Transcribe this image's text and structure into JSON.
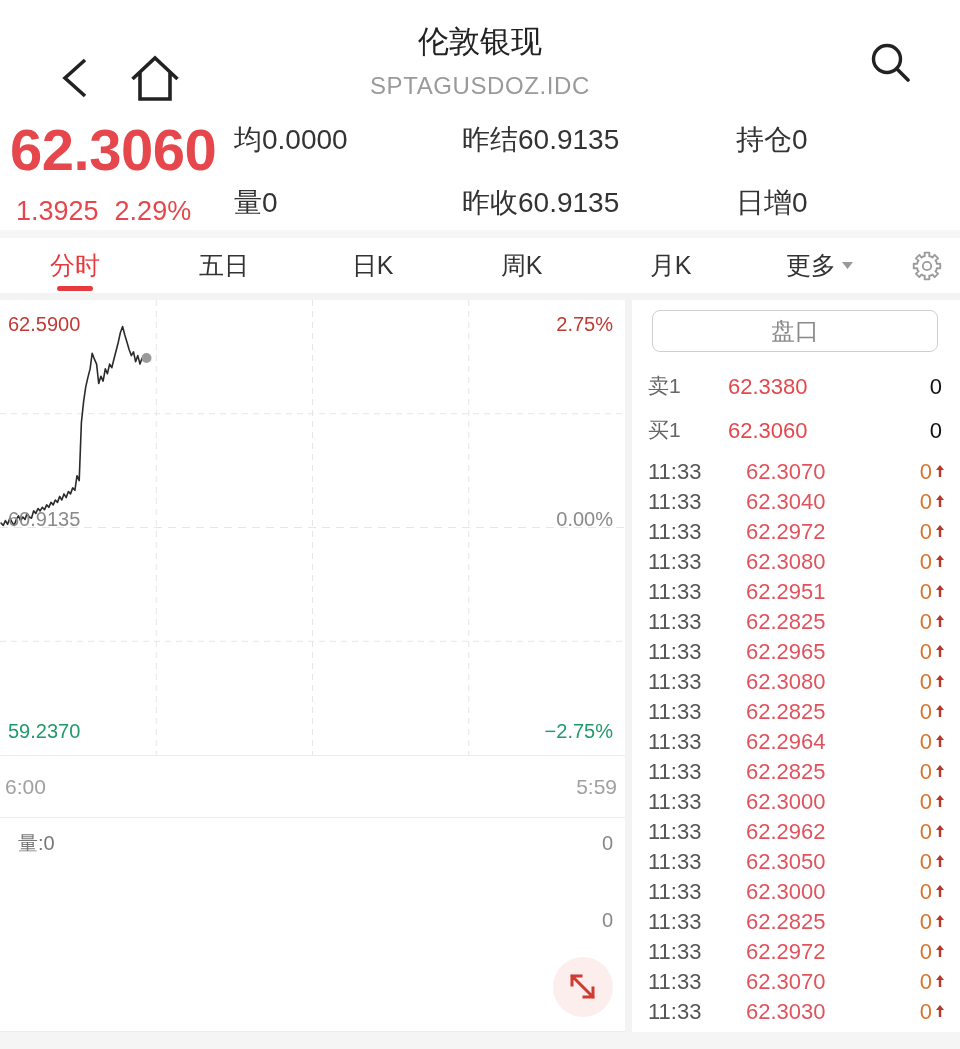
{
  "header": {
    "title": "伦敦银现",
    "code": "SPTAGUSDOZ.IDC"
  },
  "quote": {
    "price": "62.3060",
    "change": "1.3925",
    "change_pct": "2.29%",
    "rising": true,
    "stats": [
      "均0.0000",
      "昨结60.9135",
      "持仓0",
      "量0",
      "昨收60.9135",
      "日增0"
    ]
  },
  "tabs": [
    {
      "label": "分时",
      "selected": true,
      "kind": "tab"
    },
    {
      "label": "五日",
      "selected": false,
      "kind": "tab"
    },
    {
      "label": "日K",
      "selected": false,
      "kind": "tab"
    },
    {
      "label": "周K",
      "selected": false,
      "kind": "tab"
    },
    {
      "label": "月K",
      "selected": false,
      "kind": "tab"
    },
    {
      "label": "更多",
      "selected": false,
      "kind": "dropdown"
    }
  ],
  "chart": {
    "chart_data": {
      "type": "line",
      "categories": [
        null,
        null,
        null,
        null,
        null,
        null,
        null,
        null,
        null,
        null,
        null,
        null,
        null,
        null,
        null,
        null,
        null,
        null,
        null,
        null,
        null,
        null,
        null,
        null,
        null,
        null,
        null,
        null,
        null,
        null,
        null,
        null,
        null,
        null,
        null,
        null,
        null,
        null,
        null,
        null,
        null,
        null,
        null,
        null,
        null,
        null,
        null,
        null,
        null,
        null,
        null,
        null,
        null,
        null,
        null,
        null,
        null,
        null,
        null,
        null,
        null,
        null,
        null,
        null,
        null,
        null,
        null,
        null,
        null,
        null,
        null,
        null,
        null,
        null,
        null,
        null,
        null,
        null,
        null,
        null,
        null,
        null,
        null,
        null,
        null,
        null,
        null,
        null,
        null,
        null,
        null,
        null,
        null,
        null,
        null,
        null,
        null,
        null,
        null,
        null,
        null,
        null,
        null,
        null,
        null,
        null,
        null,
        null,
        null,
        null,
        null,
        null,
        null,
        null,
        null,
        null,
        null,
        null,
        null,
        null,
        null,
        null,
        null,
        null,
        null,
        null,
        null,
        null,
        null,
        null,
        null,
        null,
        null,
        null,
        null,
        null,
        null,
        null,
        null,
        null,
        null,
        null,
        null,
        null,
        null,
        null,
        null,
        null,
        null,
        null,
        null,
        null,
        null,
        null,
        null,
        null,
        null,
        null,
        null,
        null,
        null,
        null,
        null,
        null,
        null,
        null,
        null,
        null,
        null,
        null,
        null,
        null,
        null,
        null,
        null,
        null,
        null,
        null,
        null,
        null,
        null,
        null,
        null,
        null,
        null,
        null,
        null,
        null,
        null,
        null,
        null,
        null,
        null,
        null,
        null,
        null,
        null,
        null,
        null,
        null,
        null,
        null,
        null,
        null,
        null,
        null,
        null,
        null,
        null,
        null,
        null,
        null,
        null,
        null,
        null,
        null,
        null,
        null,
        null,
        null,
        null,
        null,
        null,
        null,
        null,
        null,
        null,
        null,
        null,
        null,
        null,
        null,
        null,
        null,
        null,
        null,
        null,
        null,
        null,
        null,
        null,
        null,
        null,
        null,
        null,
        null,
        null,
        null,
        null,
        null,
        null,
        null,
        null,
        null,
        null,
        null,
        null,
        null,
        null,
        null,
        null,
        null,
        null,
        null,
        null,
        null,
        null,
        null,
        null,
        null,
        null,
        null,
        null,
        null,
        null,
        null,
        null,
        null,
        null,
        null,
        null,
        null,
        null,
        null,
        null,
        null,
        null,
        null
      ],
      "series": [
        {
          "color": "#2b2b2b",
          "values": [
            60.95,
            60.93,
            60.97,
            60.94,
            60.99,
            60.96,
            60.93,
            60.98,
            61.01,
            60.97,
            61.0,
            60.98,
            61.03,
            61.0,
            60.99,
            61.05,
            61.03,
            61.07,
            61.05,
            61.08,
            61.06,
            61.1,
            61.08,
            61.12,
            61.1,
            61.14,
            61.12,
            61.17,
            61.14,
            61.19,
            61.16,
            61.21,
            61.19,
            61.24,
            61.22,
            61.34,
            61.3,
            61.78,
            61.95,
            62.07,
            62.15,
            62.22,
            62.35,
            62.3,
            62.26,
            62.1,
            62.16,
            62.12,
            62.22,
            62.18,
            62.26,
            62.23,
            62.3,
            62.37,
            62.44,
            62.52,
            62.57,
            62.5,
            62.44,
            62.38,
            62.33,
            62.36,
            62.28,
            62.33,
            62.26,
            62.31,
            62.29,
            62.31,
            null,
            null,
            null,
            null,
            null,
            null,
            null,
            null,
            null,
            null,
            null,
            null,
            null,
            null,
            null,
            null,
            null,
            null,
            null,
            null,
            null,
            null,
            null,
            null,
            null,
            null,
            null,
            null,
            null,
            null,
            null,
            null,
            null,
            null,
            null,
            null,
            null,
            null,
            null,
            null,
            null,
            null,
            null,
            null,
            null,
            null,
            null,
            null,
            null,
            null,
            null,
            null,
            null,
            null,
            null,
            null,
            null,
            null,
            null,
            null,
            null,
            null,
            null,
            null,
            null,
            null,
            null,
            null,
            null,
            null,
            null,
            null,
            null,
            null,
            null,
            null,
            null,
            null,
            null,
            null,
            null,
            null,
            null,
            null,
            null,
            null,
            null,
            null,
            null,
            null,
            null,
            null,
            null,
            null,
            null,
            null,
            null,
            null,
            null,
            null,
            null,
            null,
            null,
            null,
            null,
            null,
            null,
            null,
            null,
            null,
            null,
            null,
            null,
            null,
            null,
            null,
            null,
            null,
            null,
            null,
            null,
            null,
            null,
            null,
            null,
            null,
            null,
            null,
            null,
            null,
            null,
            null,
            null,
            null,
            null,
            null,
            null,
            null,
            null,
            null,
            null,
            null,
            null,
            null,
            null,
            null,
            null,
            null,
            null,
            null,
            null,
            null,
            null,
            null,
            null,
            null,
            null,
            null,
            null,
            null,
            null,
            null,
            null,
            null,
            null,
            null,
            null,
            null,
            null,
            null,
            null,
            null,
            null,
            null,
            null,
            null,
            null,
            null,
            null,
            null,
            null,
            null,
            null,
            null,
            null,
            null,
            null,
            null,
            null,
            null,
            null,
            null,
            null,
            null,
            null,
            null,
            null,
            null,
            null,
            null,
            null,
            null,
            null,
            null,
            null,
            null,
            null,
            null,
            null,
            null,
            null,
            null,
            null,
            null,
            null,
            null,
            null,
            null,
            null,
            null
          ]
        }
      ],
      "ylim": [
        59.039,
        62.788
      ],
      "yticks": [
        {
          "value": 62.59,
          "label": "62.5900"
        },
        {
          "value": 60.9135,
          "label": "60.9135"
        },
        {
          "value": 59.237,
          "label": "59.2370"
        }
      ]
    },
    "right_labels": [
      "2.75%",
      "0.00%",
      "−2.75%"
    ],
    "time_labels": [
      "6:00",
      "5:59"
    ]
  },
  "volume": {
    "label": "量:0",
    "scale_labels": [
      "0",
      "0"
    ]
  },
  "order_book": {
    "title": "盘口",
    "levels": [
      {
        "label": "卖1",
        "price": "62.3380",
        "volume": "0",
        "rising": true
      },
      {
        "label": "买1",
        "price": "62.3060",
        "volume": "0",
        "rising": true
      }
    ]
  },
  "trades": [
    {
      "time": "11:33",
      "price": "62.3070",
      "volume": "0",
      "up": true
    },
    {
      "time": "11:33",
      "price": "62.3040",
      "volume": "0",
      "up": true
    },
    {
      "time": "11:33",
      "price": "62.2972",
      "volume": "0",
      "up": true
    },
    {
      "time": "11:33",
      "price": "62.3080",
      "volume": "0",
      "up": true
    },
    {
      "time": "11:33",
      "price": "62.2951",
      "volume": "0",
      "up": true
    },
    {
      "time": "11:33",
      "price": "62.2825",
      "volume": "0",
      "up": true
    },
    {
      "time": "11:33",
      "price": "62.2965",
      "volume": "0",
      "up": true
    },
    {
      "time": "11:33",
      "price": "62.3080",
      "volume": "0",
      "up": true
    },
    {
      "time": "11:33",
      "price": "62.2825",
      "volume": "0",
      "up": true
    },
    {
      "time": "11:33",
      "price": "62.2964",
      "volume": "0",
      "up": true
    },
    {
      "time": "11:33",
      "price": "62.2825",
      "volume": "0",
      "up": true
    },
    {
      "time": "11:33",
      "price": "62.3000",
      "volume": "0",
      "up": true
    },
    {
      "time": "11:33",
      "price": "62.2962",
      "volume": "0",
      "up": true
    },
    {
      "time": "11:33",
      "price": "62.3050",
      "volume": "0",
      "up": true
    },
    {
      "time": "11:33",
      "price": "62.3000",
      "volume": "0",
      "up": true
    },
    {
      "time": "11:33",
      "price": "62.2825",
      "volume": "0",
      "up": true
    },
    {
      "time": "11:33",
      "price": "62.2972",
      "volume": "0",
      "up": true
    },
    {
      "time": "11:33",
      "price": "62.3070",
      "volume": "0",
      "up": true
    },
    {
      "time": "11:33",
      "price": "62.3030",
      "volume": "0",
      "up": true
    }
  ]
}
